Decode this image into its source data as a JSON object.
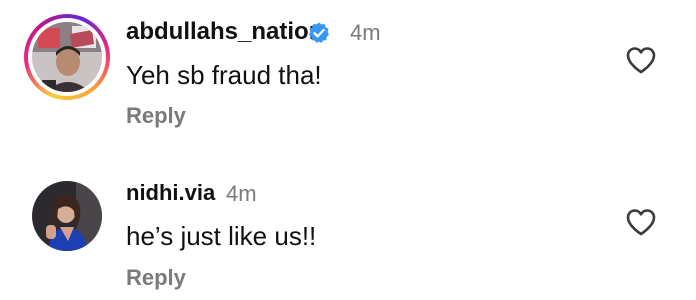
{
  "comments": [
    {
      "username": "abdullahs_nation",
      "verified": true,
      "time": "4m",
      "text": "Yeh sb fraud tha!",
      "reply_label": "Reply",
      "has_story_ring": true
    },
    {
      "username": "nidhi.via",
      "verified": false,
      "time": "4m",
      "text": "he’s just like us!!",
      "reply_label": "Reply",
      "has_story_ring": false
    }
  ],
  "colors": {
    "verified_badge": "#3897f0",
    "muted_text": "#7a7a7a",
    "primary_text": "#111111"
  },
  "icons": {
    "like": "heart-outline-icon",
    "verified": "verified-badge-icon"
  }
}
